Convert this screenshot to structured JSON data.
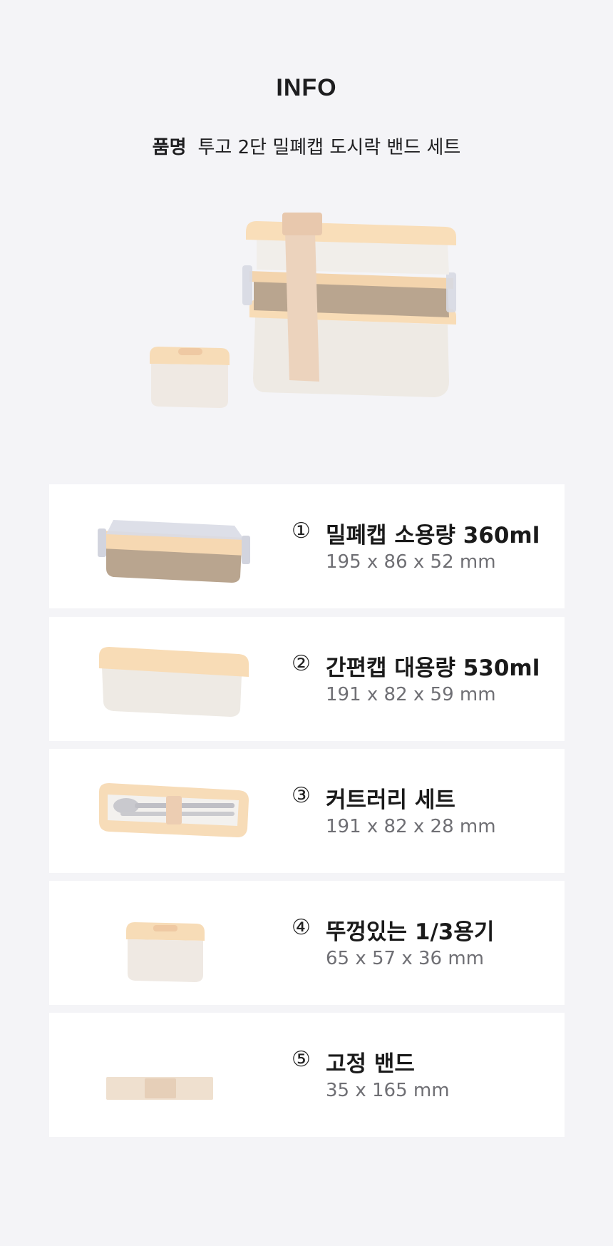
{
  "header": {
    "title": "INFO",
    "product_label": "품명",
    "product_name": "투고 2단 밀폐캡 도시락 밴드 세트"
  },
  "colors": {
    "background": "#f4f4f7",
    "card": "#ffffff",
    "lid_peach": "#f8dcb6",
    "body_cream": "#eeeae4",
    "body_taupe": "#b9a58f",
    "band": "#ecd3bd"
  },
  "items": [
    {
      "num": "①",
      "name": "밀폐캡 소용량 360ml",
      "dims": "195 x 86 x 52 mm"
    },
    {
      "num": "②",
      "name": "간편캡 대용량 530ml",
      "dims": "191 x 82 x 59 mm"
    },
    {
      "num": "③",
      "name": "커트러리 세트",
      "dims": "191 x 82 x 28 mm"
    },
    {
      "num": "④",
      "name": "뚜껑있는 1/3용기",
      "dims": "65 x 57 x 36 mm"
    },
    {
      "num": "⑤",
      "name": "고정 밴드",
      "dims": "35 x 165 mm"
    }
  ]
}
